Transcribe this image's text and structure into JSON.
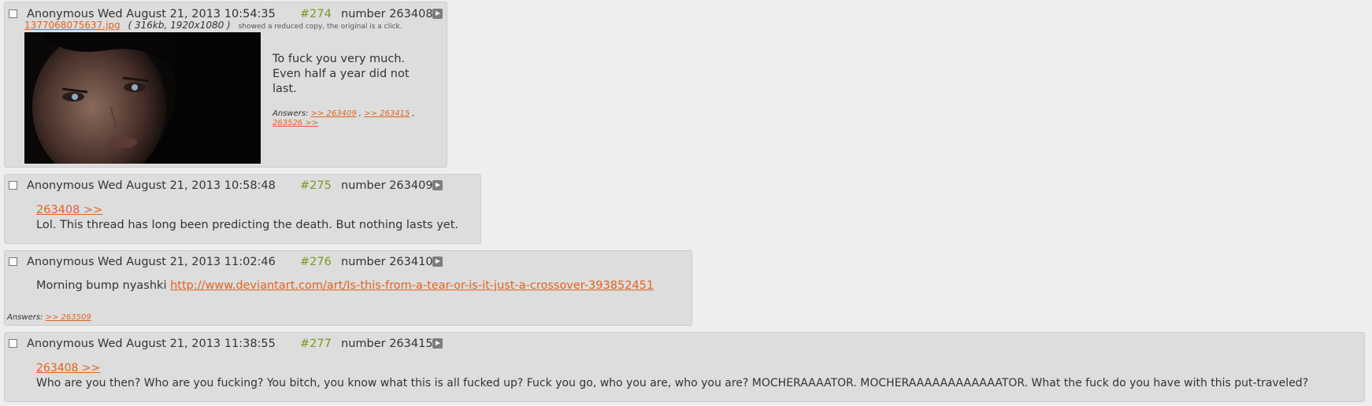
{
  "posts": [
    {
      "name": "Anonymous",
      "date": "Wed August 21, 2013 10:54:35",
      "num": "#274",
      "number": "number 263408",
      "file": {
        "name": "1377068075637.jpg",
        "meta": "( 316kb, 1920x1080 )",
        "note": "showed a reduced copy, the original is a click."
      },
      "text_lines": [
        "To fuck you very much.",
        "Even half a year did not",
        "last."
      ],
      "answers_label": "Answers:",
      "answers": [
        ">> 263409",
        ">> 263415",
        "263526 >>"
      ]
    },
    {
      "name": "Anonymous",
      "date": "Wed August 21, 2013 10:58:48",
      "num": "#275",
      "number": "number 263409",
      "quote_link": "263408 >>",
      "text": "Lol. This thread has long been predicting the death. But nothing lasts yet."
    },
    {
      "name": "Anonymous",
      "date": "Wed August 21, 2013 11:02:46",
      "num": "#276",
      "number": "number 263410",
      "text": "Morning bump nyashki",
      "url": "http://www.deviantart.com/art/Is-this-from-a-tear-or-is-it-just-a-crossover-393852451",
      "answers_label": "Answers:",
      "answers": [
        ">> 263509"
      ]
    },
    {
      "name": "Anonymous",
      "date": "Wed August 21, 2013 11:38:55",
      "num": "#277",
      "number": "number 263415",
      "quote_link": "263408 >>",
      "text": "Who are you then? Who are you fucking? You bitch, you know what this is all fucked up? Fuck you go, who you are, who you are? MOCHERAAAATOR. MOCHERAAAAAAAAAAAATOR. What the fuck do you have with this put-traveled?"
    }
  ],
  "colors": {
    "background": "#eeeeee",
    "post_bg": "#dddddd",
    "link": "#e0631e",
    "post_num": "#789922"
  }
}
